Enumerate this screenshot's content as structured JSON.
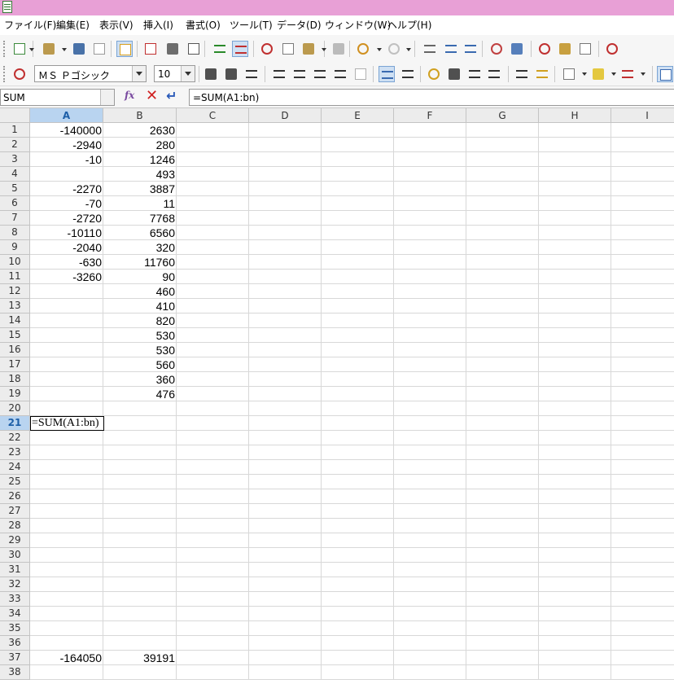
{
  "menubar": {
    "items": [
      "ファイル(F)",
      "編集(E)",
      "表示(V)",
      "挿入(I)",
      "書式(O)",
      "ツール(T)",
      "データ(D)",
      "ウィンドウ(W)",
      "ヘルプ(H)"
    ]
  },
  "toolbar_format": {
    "font_name": "ＭＳ Ｐゴシック",
    "font_size": "10"
  },
  "formula_bar": {
    "name_box": "SUM",
    "formula": "=SUM(A1:bn)"
  },
  "sheet": {
    "columns": [
      "A",
      "B",
      "C",
      "D",
      "E",
      "F",
      "G",
      "H",
      "I"
    ],
    "selected_column": "A",
    "selected_row": "21",
    "col_a": [
      "-140000",
      "-2940",
      "-10",
      "",
      "-2270",
      "-70",
      "-2720",
      "-10110",
      "-2040",
      "-630",
      "-3260"
    ],
    "col_b": [
      "2630",
      "280",
      "1246",
      "493",
      "3887",
      "11",
      "7768",
      "6560",
      "320",
      "11760",
      "90",
      "460",
      "410",
      "820",
      "530",
      "530",
      "560",
      "360",
      "476"
    ],
    "editing_cell": "A21",
    "editing_text": "=SUM(A1:bn)",
    "total_row": "37",
    "total_a": "-164050",
    "total_b": "39191"
  }
}
